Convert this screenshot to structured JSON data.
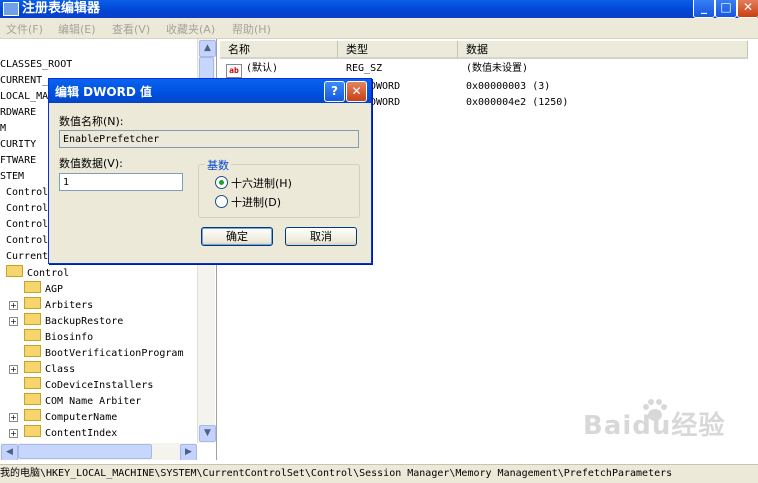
{
  "window": {
    "title": "注册表编辑器"
  },
  "menu": [
    "文件(F)",
    "编辑(E)",
    "查看(V)",
    "收藏夹(A)",
    "帮助(H)"
  ],
  "tree": {
    "items": [
      "CLASSES_ROOT",
      "CURRENT_",
      "LOCAL_MA",
      "RDWARE",
      "M",
      "CURITY",
      "FTWARE",
      "STEM",
      "Control",
      "Control",
      "Control",
      "Control",
      "Current",
      "Control",
      "AGP",
      "Arbiters",
      "BackupRestore",
      "Biosinfo",
      "BootVerificationProgram",
      "Class",
      "CoDeviceInstallers",
      "COM Name Arbiter",
      "ComputerName",
      "ContentIndex"
    ]
  },
  "list": {
    "columns": [
      "名称",
      "类型",
      "数据"
    ],
    "rows": [
      {
        "name": "(默认)",
        "type": "REG_SZ",
        "data": "(数值未设置)"
      },
      {
        "name": "",
        "type": "DWORD",
        "data": "0x00000003 (3)"
      },
      {
        "name": "",
        "type": "DWORD",
        "data": "0x000004e2 (1250)"
      }
    ]
  },
  "dialog": {
    "title": "编辑 DWORD 值",
    "name_label": "数值名称(N):",
    "name_value": "EnablePrefetcher",
    "data_label": "数值数据(V):",
    "data_value": "1",
    "base_title": "基数",
    "radio_hex": "十六进制(H)",
    "radio_dec": "十进制(D)",
    "ok": "确定",
    "cancel": "取消"
  },
  "statusbar": "我的电脑\\HKEY_LOCAL_MACHINE\\SYSTEM\\CurrentControlSet\\Control\\Session Manager\\Memory Management\\PrefetchParameters",
  "watermark": "Baidu经验"
}
